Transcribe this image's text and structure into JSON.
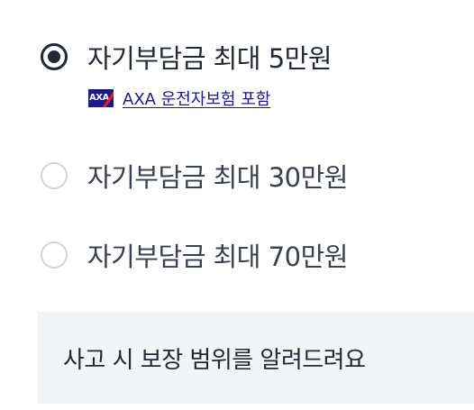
{
  "options": [
    {
      "label": "자기부담금 최대 5만원",
      "selected": true
    },
    {
      "label": "자기부담금 최대 30만원",
      "selected": false
    },
    {
      "label": "자기부담금 최대 70만원",
      "selected": false
    }
  ],
  "selected_detail": {
    "logo_text": "AXA",
    "link_text": "AXA 운전자보험 포함",
    "logo_color": "#1a1a8c",
    "logo_accent": "#ff1721"
  },
  "info_box": {
    "text": "사고 시 보장 범위를 알려드려요"
  }
}
